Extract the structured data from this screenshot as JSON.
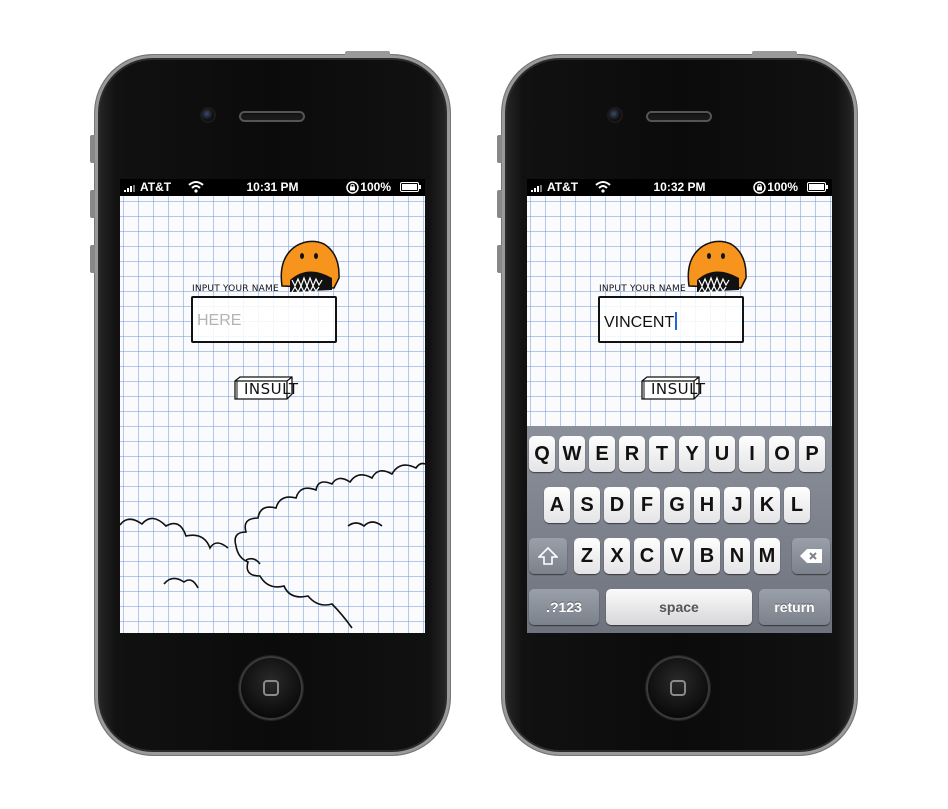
{
  "phones": [
    {
      "status": {
        "carrier": "AT&T",
        "time": "10:31 PM",
        "battery": "100%"
      },
      "app": {
        "label": "INPUT YOUR NAME",
        "placeholder": "HERE",
        "button": "INSULT"
      }
    },
    {
      "status": {
        "carrier": "AT&T",
        "time": "10:32 PM",
        "battery": "100%"
      },
      "app": {
        "label": "INPUT YOUR NAME",
        "value": "VINCENT",
        "button": "INSULT"
      },
      "keyboard": {
        "row1": [
          "Q",
          "W",
          "E",
          "R",
          "T",
          "Y",
          "U",
          "I",
          "O",
          "P"
        ],
        "row2": [
          "A",
          "S",
          "D",
          "F",
          "G",
          "H",
          "J",
          "K",
          "L"
        ],
        "row3": [
          "Z",
          "X",
          "C",
          "V",
          "B",
          "N",
          "M"
        ],
        "numbers_key": ".?123",
        "space_key": "space",
        "return_key": "return"
      }
    }
  ],
  "colors": {
    "monster": "#f7941d",
    "grid": "#78a0dc",
    "caret": "#2466d8"
  }
}
